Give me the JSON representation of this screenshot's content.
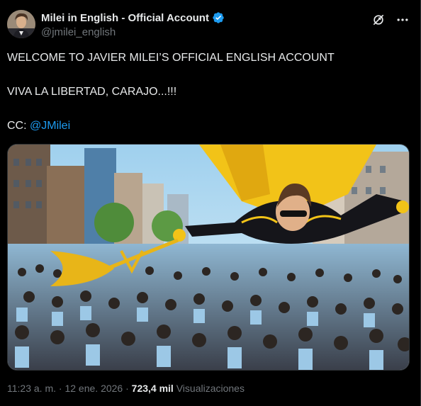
{
  "author": {
    "display_name": "Milei in English - Official Account",
    "handle": "@jmilei_english"
  },
  "tweet": {
    "line1": "WELCOME TO JAVIER MILEI’S OFFICIAL ENGLISH ACCOUNT",
    "line2": "VIVA LA LIBERTAD, CARAJO...!!!",
    "line3_prefix": "CC: ",
    "mention": "@JMilei"
  },
  "meta": {
    "time": "11:23 a. m.",
    "separator1": " · ",
    "date": "12 ene. 2026",
    "separator2": " · ",
    "views_count": "723,4 mil",
    "views_label": " Visualizaciones"
  },
  "icons": {
    "verified": "verified-badge-icon",
    "grok": "grok-icon",
    "more": "more-options-icon"
  },
  "colors": {
    "background": "#000000",
    "text": "#e7e9ea",
    "secondary_text": "#71767b",
    "link": "#1d9bf0",
    "verified": "#1d9bf0"
  }
}
